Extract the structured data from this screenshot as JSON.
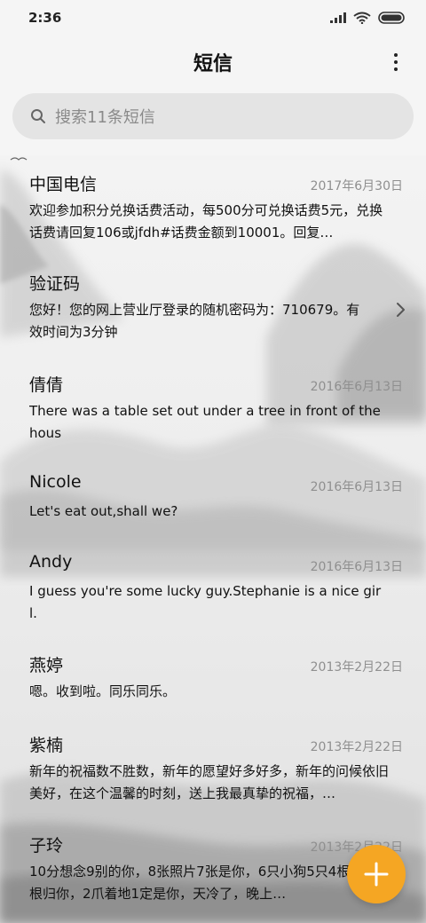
{
  "status_bar": {
    "time": "2:36"
  },
  "header": {
    "title": "短信"
  },
  "search": {
    "placeholder": "搜索11条短信"
  },
  "conversations": [
    {
      "name": "中国电信",
      "date": "2017年6月30日",
      "preview": "欢迎参加积分兑换话费活动，每500分可兑换话费5元，兑换话费请回复106或jfdh#话费金额到10001。回复…"
    },
    {
      "name": "验证码",
      "date": "",
      "preview": "您好！您的网上营业厅登录的随机密码为：710679。有效时间为3分钟"
    },
    {
      "name": "倩倩",
      "date": "2016年6月13日",
      "preview": "There was a table set out under a tree in front of the hous"
    },
    {
      "name": "Nicole",
      "date": "2016年6月13日",
      "preview": "Let's eat out,shall we?"
    },
    {
      "name": "Andy",
      "date": "2016年6月13日",
      "preview": "I guess you're some lucky guy.Stephanie is a nice girl."
    },
    {
      "name": "燕婷",
      "date": "2013年2月22日",
      "preview": "嗯。收到啦。同乐同乐。"
    },
    {
      "name": "紫楠",
      "date": "2013年2月22日",
      "preview": "新年的祝福数不胜数，新年的愿望好多好多，新年的问候依旧美好，在这个温馨的时刻，送上我最真挚的祝福，…"
    },
    {
      "name": "子玲",
      "date": "2013年2月22日",
      "preview": "10分想念9别的你，8张照片7张是你，6只小狗5只4根骨头3根归你，2爪着地1定是你，天冷了，晚上…"
    }
  ],
  "icons": {
    "menu": "more-vertical-icon",
    "search": "search-icon",
    "chevron": "chevron-right-icon",
    "fab": "plus-icon"
  },
  "colors": {
    "fab": "#f5a623",
    "date": "#8f8f8f",
    "search_bg": "#e4e4e4"
  }
}
